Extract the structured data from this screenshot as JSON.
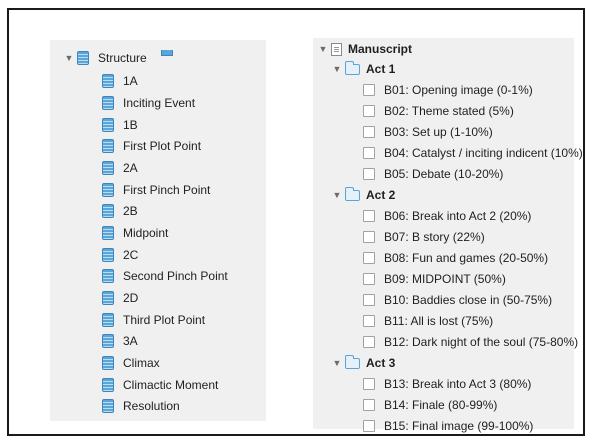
{
  "binder_left": {
    "group_label": "Structure",
    "items": [
      {
        "label": "1A"
      },
      {
        "label": "Inciting Event"
      },
      {
        "label": "1B"
      },
      {
        "label": "First Plot Point"
      },
      {
        "label": "2A"
      },
      {
        "label": "First Pinch Point"
      },
      {
        "label": "2B"
      },
      {
        "label": "Midpoint"
      },
      {
        "label": "2C"
      },
      {
        "label": "Second Pinch Point"
      },
      {
        "label": "2D"
      },
      {
        "label": "Third Plot Point"
      },
      {
        "label": "3A"
      },
      {
        "label": "Climax"
      },
      {
        "label": "Climactic Moment"
      },
      {
        "label": "Resolution"
      }
    ]
  },
  "binder_right": {
    "root_label": "Manuscript",
    "acts": [
      {
        "label": "Act 1",
        "beats": [
          {
            "label": "B01: Opening image (0-1%)"
          },
          {
            "label": "B02: Theme stated (5%)"
          },
          {
            "label": "B03: Set up (1-10%)"
          },
          {
            "label": "B04: Catalyst / inciting indicent (10%)"
          },
          {
            "label": "B05: Debate (10-20%)"
          }
        ]
      },
      {
        "label": "Act 2",
        "beats": [
          {
            "label": "B06: Break into Act 2 (20%)"
          },
          {
            "label": "B07: B story (22%)"
          },
          {
            "label": "B08: Fun and games (20-50%)"
          },
          {
            "label": "B09: MIDPOINT (50%)"
          },
          {
            "label": "B10: Baddies close in (50-75%)"
          },
          {
            "label": "B11: All is lost (75%)"
          },
          {
            "label": "B12: Dark night of the soul (75-80%)"
          }
        ]
      },
      {
        "label": "Act 3",
        "beats": [
          {
            "label": "B13: Break into Act 3 (80%)"
          },
          {
            "label": "B14: Finale (80-99%)"
          },
          {
            "label": "B15: Final image (99-100%)"
          }
        ]
      }
    ]
  },
  "icons": {
    "document": "document-stack-icon",
    "folder": "folder-icon",
    "manuscript": "manuscript-icon",
    "beat": "index-card-icon",
    "disclosure": "disclosure-triangle-icon"
  },
  "colors": {
    "panel_bg": "#f0f0f0",
    "icon_blue": "#5aa6d8",
    "frame_border": "#1a1a1a"
  }
}
